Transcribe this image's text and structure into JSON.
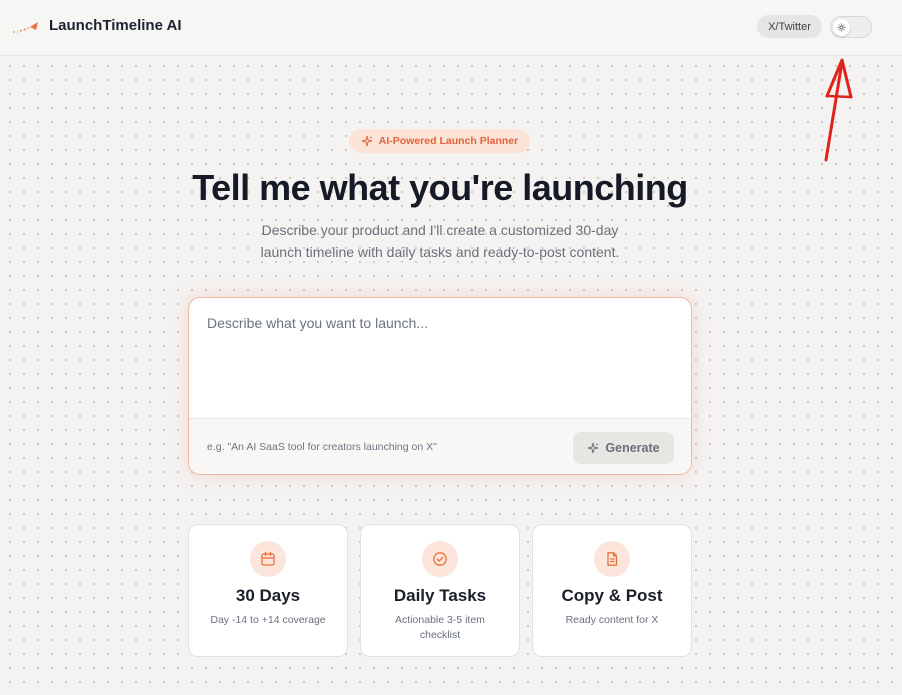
{
  "header": {
    "app_title": "LaunchTimeline AI",
    "platform_pill": "X/Twitter",
    "logo_icon": "rocket-trail-icon",
    "theme_toggle_icon": "sun-icon"
  },
  "annotation": {
    "arrow_color": "#e0241c"
  },
  "hero": {
    "badge": "AI-Powered Launch Planner",
    "badge_icon": "sparkles-icon",
    "title": "Tell me what you're launching",
    "subtitle": "Describe your product and I'll create a customized 30-day launch timeline with daily tasks and ready-to-post content."
  },
  "input": {
    "placeholder": "Describe what you want to launch...",
    "value": "",
    "example": "e.g. \"An AI SaaS tool for creators launching on X\"",
    "generate_label": "Generate",
    "generate_icon": "sparkles-icon"
  },
  "features": [
    {
      "icon": "calendar-icon",
      "title": "30 Days",
      "desc": "Day -14 to +14 coverage"
    },
    {
      "icon": "check-circle-icon",
      "title": "Daily Tasks",
      "desc": "Actionable 3-5 item checklist"
    },
    {
      "icon": "document-icon",
      "title": "Copy & Post",
      "desc": "Ready content for X"
    }
  ],
  "colors": {
    "accent": "#e8713f",
    "accent_soft": "#fce6db",
    "background": "#f4f3f2",
    "text_dark": "#151a26"
  }
}
